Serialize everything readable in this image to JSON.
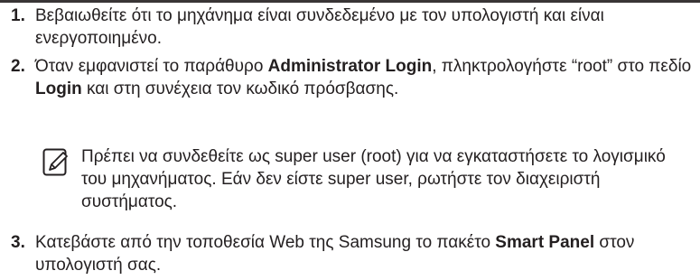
{
  "steps": [
    {
      "number": "1.",
      "text": "Βεβαιωθείτε ότι το μηχάνημα είναι συνδεδεμένο με τον υπολογιστή και είναι ενεργοποιημένο."
    },
    {
      "number": "2.",
      "text_before_bold1": "Όταν εμφανιστεί το παράθυρο ",
      "bold1": "Administrator Login",
      "text_after_bold1": ", πληκτρολογήστε “root” στο πεδίο ",
      "bold2": "Login",
      "text_after_bold2": " και στη συνέχεια τον κωδικό πρόσβασης."
    },
    {
      "number": "3.",
      "text_before_bold": "Κατεβάστε από την τοποθεσία Web της Samsung το πακέτο ",
      "bold": "Smart Panel",
      "text_after_bold": " στον υπολογιστή σας."
    }
  ],
  "note": {
    "icon": "note-pencil-icon",
    "text": "Πρέπει να συνδεθείτε ως super user (root) για να εγκαταστήσετε το λογισμικό του μηχανήματος. Εάν δεν είστε super user, ρωτήστε τον διαχειριστή συστήματος."
  }
}
